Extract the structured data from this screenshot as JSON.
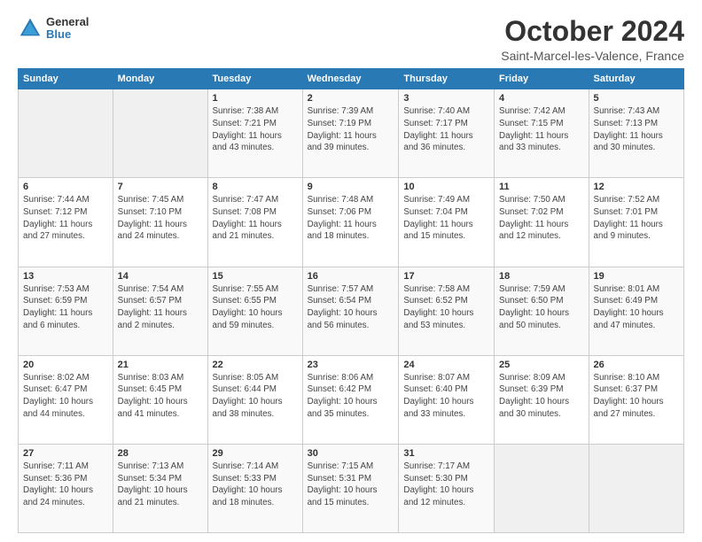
{
  "logo": {
    "general": "General",
    "blue": "Blue"
  },
  "header": {
    "month": "October 2024",
    "location": "Saint-Marcel-les-Valence, France"
  },
  "days_of_week": [
    "Sunday",
    "Monday",
    "Tuesday",
    "Wednesday",
    "Thursday",
    "Friday",
    "Saturday"
  ],
  "weeks": [
    [
      {
        "day": "",
        "info": ""
      },
      {
        "day": "",
        "info": ""
      },
      {
        "day": "1",
        "info": "Sunrise: 7:38 AM\nSunset: 7:21 PM\nDaylight: 11 hours\nand 43 minutes."
      },
      {
        "day": "2",
        "info": "Sunrise: 7:39 AM\nSunset: 7:19 PM\nDaylight: 11 hours\nand 39 minutes."
      },
      {
        "day": "3",
        "info": "Sunrise: 7:40 AM\nSunset: 7:17 PM\nDaylight: 11 hours\nand 36 minutes."
      },
      {
        "day": "4",
        "info": "Sunrise: 7:42 AM\nSunset: 7:15 PM\nDaylight: 11 hours\nand 33 minutes."
      },
      {
        "day": "5",
        "info": "Sunrise: 7:43 AM\nSunset: 7:13 PM\nDaylight: 11 hours\nand 30 minutes."
      }
    ],
    [
      {
        "day": "6",
        "info": "Sunrise: 7:44 AM\nSunset: 7:12 PM\nDaylight: 11 hours\nand 27 minutes."
      },
      {
        "day": "7",
        "info": "Sunrise: 7:45 AM\nSunset: 7:10 PM\nDaylight: 11 hours\nand 24 minutes."
      },
      {
        "day": "8",
        "info": "Sunrise: 7:47 AM\nSunset: 7:08 PM\nDaylight: 11 hours\nand 21 minutes."
      },
      {
        "day": "9",
        "info": "Sunrise: 7:48 AM\nSunset: 7:06 PM\nDaylight: 11 hours\nand 18 minutes."
      },
      {
        "day": "10",
        "info": "Sunrise: 7:49 AM\nSunset: 7:04 PM\nDaylight: 11 hours\nand 15 minutes."
      },
      {
        "day": "11",
        "info": "Sunrise: 7:50 AM\nSunset: 7:02 PM\nDaylight: 11 hours\nand 12 minutes."
      },
      {
        "day": "12",
        "info": "Sunrise: 7:52 AM\nSunset: 7:01 PM\nDaylight: 11 hours\nand 9 minutes."
      }
    ],
    [
      {
        "day": "13",
        "info": "Sunrise: 7:53 AM\nSunset: 6:59 PM\nDaylight: 11 hours\nand 6 minutes."
      },
      {
        "day": "14",
        "info": "Sunrise: 7:54 AM\nSunset: 6:57 PM\nDaylight: 11 hours\nand 2 minutes."
      },
      {
        "day": "15",
        "info": "Sunrise: 7:55 AM\nSunset: 6:55 PM\nDaylight: 10 hours\nand 59 minutes."
      },
      {
        "day": "16",
        "info": "Sunrise: 7:57 AM\nSunset: 6:54 PM\nDaylight: 10 hours\nand 56 minutes."
      },
      {
        "day": "17",
        "info": "Sunrise: 7:58 AM\nSunset: 6:52 PM\nDaylight: 10 hours\nand 53 minutes."
      },
      {
        "day": "18",
        "info": "Sunrise: 7:59 AM\nSunset: 6:50 PM\nDaylight: 10 hours\nand 50 minutes."
      },
      {
        "day": "19",
        "info": "Sunrise: 8:01 AM\nSunset: 6:49 PM\nDaylight: 10 hours\nand 47 minutes."
      }
    ],
    [
      {
        "day": "20",
        "info": "Sunrise: 8:02 AM\nSunset: 6:47 PM\nDaylight: 10 hours\nand 44 minutes."
      },
      {
        "day": "21",
        "info": "Sunrise: 8:03 AM\nSunset: 6:45 PM\nDaylight: 10 hours\nand 41 minutes."
      },
      {
        "day": "22",
        "info": "Sunrise: 8:05 AM\nSunset: 6:44 PM\nDaylight: 10 hours\nand 38 minutes."
      },
      {
        "day": "23",
        "info": "Sunrise: 8:06 AM\nSunset: 6:42 PM\nDaylight: 10 hours\nand 35 minutes."
      },
      {
        "day": "24",
        "info": "Sunrise: 8:07 AM\nSunset: 6:40 PM\nDaylight: 10 hours\nand 33 minutes."
      },
      {
        "day": "25",
        "info": "Sunrise: 8:09 AM\nSunset: 6:39 PM\nDaylight: 10 hours\nand 30 minutes."
      },
      {
        "day": "26",
        "info": "Sunrise: 8:10 AM\nSunset: 6:37 PM\nDaylight: 10 hours\nand 27 minutes."
      }
    ],
    [
      {
        "day": "27",
        "info": "Sunrise: 7:11 AM\nSunset: 5:36 PM\nDaylight: 10 hours\nand 24 minutes."
      },
      {
        "day": "28",
        "info": "Sunrise: 7:13 AM\nSunset: 5:34 PM\nDaylight: 10 hours\nand 21 minutes."
      },
      {
        "day": "29",
        "info": "Sunrise: 7:14 AM\nSunset: 5:33 PM\nDaylight: 10 hours\nand 18 minutes."
      },
      {
        "day": "30",
        "info": "Sunrise: 7:15 AM\nSunset: 5:31 PM\nDaylight: 10 hours\nand 15 minutes."
      },
      {
        "day": "31",
        "info": "Sunrise: 7:17 AM\nSunset: 5:30 PM\nDaylight: 10 hours\nand 12 minutes."
      },
      {
        "day": "",
        "info": ""
      },
      {
        "day": "",
        "info": ""
      }
    ]
  ]
}
